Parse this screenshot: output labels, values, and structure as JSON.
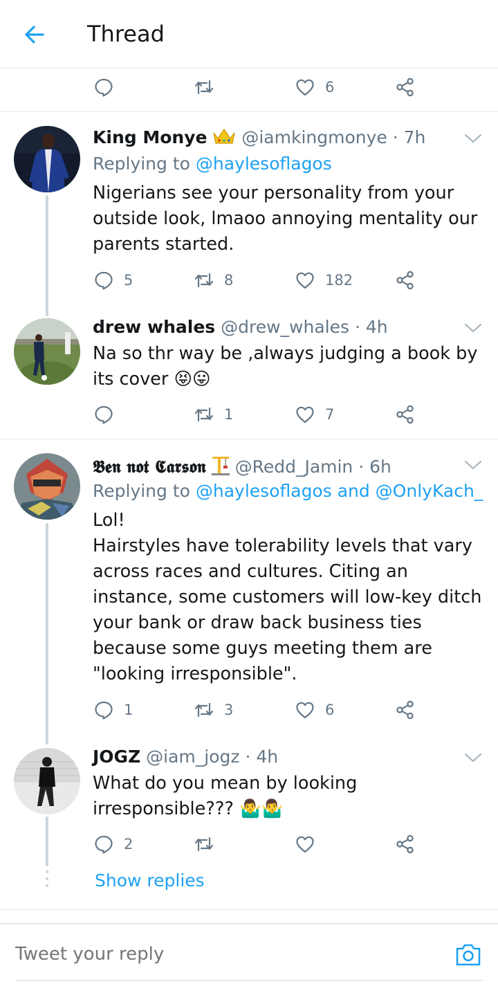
{
  "header": {
    "title": "Thread"
  },
  "colors": {
    "accent": "#1da1f2",
    "muted": "#657786",
    "text": "#14171a",
    "divider": "#e1e8ed",
    "thread_line": "#ccd6dd"
  },
  "top_actions": {
    "reply_count": "",
    "retweet_count": "",
    "like_count": "6"
  },
  "tweets": [
    {
      "name": "King Monye",
      "badge_icon": "crown-emoji",
      "handle": "@iamkingmonye",
      "time": "· 7h",
      "replying_prefix": "Replying to ",
      "replying_to": "@haylesoflagos",
      "text": "Nigerians see your personality from your outside look, lmaoo annoying mentality our parents started.",
      "reply_count": "5",
      "retweet_count": "8",
      "like_count": "182"
    },
    {
      "name": "drew whales",
      "handle": "@drew_whales",
      "time": "· 4h",
      "text": "Na so thr way be ,always judging a book by its cover 😝😛",
      "reply_count": "",
      "retweet_count": "1",
      "like_count": "7"
    },
    {
      "name": "𝕭𝖊𝖓 𝖓𝖔𝖙 𝕮𝖆𝖗𝖘𝖔𝖓",
      "badge_icon": "construction-crane-emoji",
      "handle": "@Redd_Jamin",
      "time": "· 6h",
      "replying_prefix": "Replying to ",
      "replying_to": "@haylesoflagos and @OnlyKach_",
      "text_lines": [
        "Lol!",
        "Hairstyles have tolerability levels that vary across races and cultures. Citing an instance, some customers will low-key ditch your bank or draw back business ties because some guys meeting them are \"looking irresponsible\"."
      ],
      "reply_count": "1",
      "retweet_count": "3",
      "like_count": "6"
    },
    {
      "name": "JOGZ",
      "handle": "@iam_jogz",
      "time": "· 4h",
      "text": "What do you mean by looking irresponsible??? 🤷‍♂️🤷‍♂️",
      "reply_count": "2",
      "retweet_count": "",
      "like_count": ""
    }
  ],
  "show_replies": "Show replies",
  "reply_bar": {
    "placeholder": "Tweet your reply"
  }
}
